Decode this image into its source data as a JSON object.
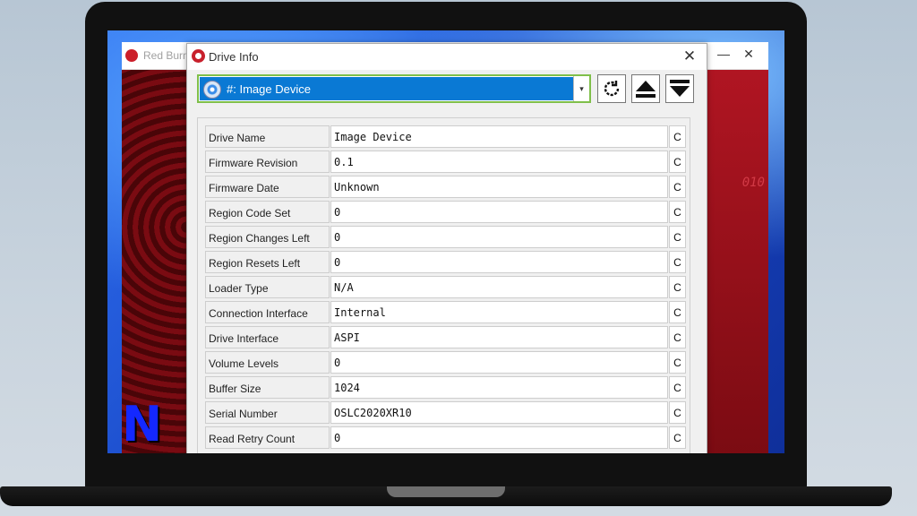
{
  "back_window": {
    "title": "Red Burn",
    "minimize_label": "—",
    "close_label": "✕",
    "side_text": "010",
    "corner_logo": "N"
  },
  "dialog": {
    "title": "Drive Info",
    "close_label": "✕",
    "drive_selected": "#: Image Device",
    "dropdown_arrow": "▾",
    "refresh_icon": "refresh-icon",
    "eject_icon": "eject-icon",
    "load_icon": "load-tray-icon",
    "copy_label": "C"
  },
  "rows": [
    {
      "label": "Drive Name",
      "value": "Image Device"
    },
    {
      "label": "Firmware Revision",
      "value": "0.1"
    },
    {
      "label": "Firmware Date",
      "value": "Unknown"
    },
    {
      "label": "Region Code Set",
      "value": "0"
    },
    {
      "label": "Region Changes Left",
      "value": "0"
    },
    {
      "label": "Region Resets Left",
      "value": "0"
    },
    {
      "label": "Loader Type",
      "value": "N/A"
    },
    {
      "label": "Connection Interface",
      "value": "Internal"
    },
    {
      "label": "Drive Interface",
      "value": "ASPI"
    },
    {
      "label": "Volume Levels",
      "value": "0"
    },
    {
      "label": "Buffer Size",
      "value": "1024"
    },
    {
      "label": "Serial Number",
      "value": "OSLC2020XR10"
    },
    {
      "label": "Read Retry Count",
      "value": "0"
    }
  ]
}
